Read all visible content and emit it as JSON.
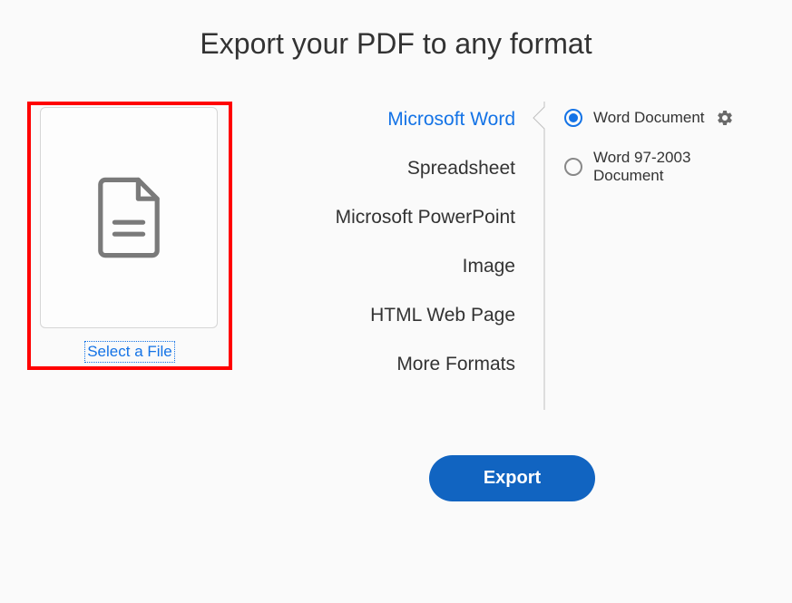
{
  "title": "Export your PDF to any format",
  "file": {
    "select_label": "Select a File"
  },
  "formats": [
    {
      "label": "Microsoft Word",
      "selected": true
    },
    {
      "label": "Spreadsheet",
      "selected": false
    },
    {
      "label": "Microsoft PowerPoint",
      "selected": false
    },
    {
      "label": "Image",
      "selected": false
    },
    {
      "label": "HTML Web Page",
      "selected": false
    },
    {
      "label": "More Formats",
      "selected": false
    }
  ],
  "options": [
    {
      "label": "Word Document",
      "selected": true,
      "has_settings": true
    },
    {
      "label": "Word 97-2003 Document",
      "selected": false,
      "has_settings": false
    }
  ],
  "export_button": "Export"
}
